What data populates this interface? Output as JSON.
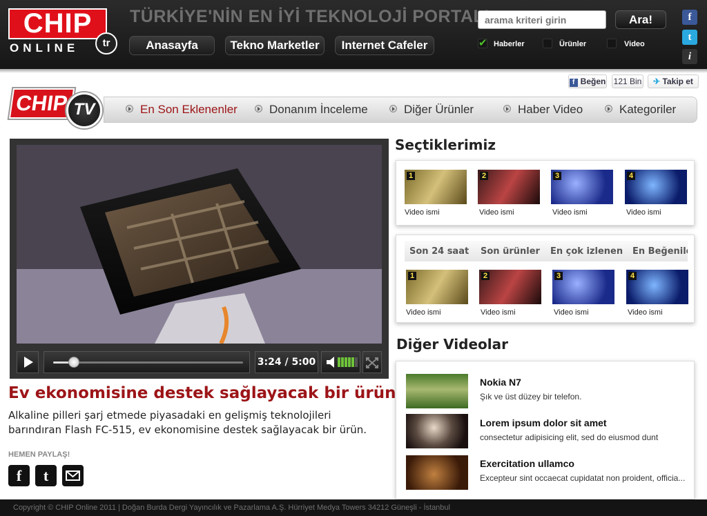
{
  "header": {
    "logo_main": "CHIP",
    "logo_sub": "ONLINE",
    "logo_badge": "tr",
    "tagline": "TÜRKİYE'NİN EN İYİ TEKNOLOJİ PORTALI",
    "nav": [
      "Anasayfa",
      "Tekno Marketler",
      "Internet Cafeler"
    ],
    "search_placeholder": "arama kriteri girin",
    "search_button": "Ara!",
    "filters": [
      {
        "label": "Haberler",
        "checked": true
      },
      {
        "label": "Ürünler",
        "checked": false
      },
      {
        "label": "Video",
        "checked": false
      }
    ],
    "social_icons": [
      "facebook-icon",
      "twitter-icon",
      "info-icon"
    ]
  },
  "social_strip": {
    "like_label": "Beğen",
    "like_count": "121 Bin",
    "follow_label": "Takip et"
  },
  "tv": {
    "logo_main": "CHIP",
    "logo_badge": "TV",
    "nav": [
      {
        "label": "En Son Eklenenler",
        "active": true
      },
      {
        "label": "Donanım İnceleme",
        "active": false
      },
      {
        "label": "Diğer Ürünler",
        "active": false
      },
      {
        "label": "Haber Video",
        "active": false
      },
      {
        "label": "Kategoriler",
        "active": false
      }
    ]
  },
  "player": {
    "current_time": "3:24",
    "separator": "/",
    "duration": "5:00",
    "progress": 0.11,
    "volume_level": 0.8
  },
  "video": {
    "title": "Ev ekonomisine destek sağlayacak bir ürün.",
    "description": "Alkaline pilleri şarj etmede piyasadaki en gelişmiş teknolojileri barındıran Flash FC-515, ev ekonomisine destek sağlayacak bir ürün.",
    "share_label": "HEMEN PAYLAŞ!"
  },
  "picks": {
    "heading": "Seçtiklerimiz",
    "items": [
      {
        "num": "1",
        "caption": "Video ismi"
      },
      {
        "num": "2",
        "caption": "Video ismi"
      },
      {
        "num": "3",
        "caption": "Video ismi"
      },
      {
        "num": "4",
        "caption": "Video ismi"
      }
    ]
  },
  "tabs": {
    "labels": [
      "Son 24 saat",
      "Son ürünler",
      "En çok izlenen",
      "En Beğenile"
    ],
    "items": [
      {
        "num": "1",
        "caption": "Video ismi"
      },
      {
        "num": "2",
        "caption": "Video ismi"
      },
      {
        "num": "3",
        "caption": "Video ismi"
      },
      {
        "num": "4",
        "caption": "Video ismi"
      }
    ]
  },
  "other_videos": {
    "heading": "Diğer Videolar",
    "items": [
      {
        "title": "Nokia N7",
        "desc": "Şık ve üst düzey bir telefon."
      },
      {
        "title": "Lorem ipsum dolor sit amet",
        "desc": "consectetur adipisicing elit, sed do eiusmod dunt"
      },
      {
        "title": "Exercitation ullamco",
        "desc": "Excepteur sint occaecat cupidatat non proident, officia..."
      }
    ]
  },
  "footer": {
    "text": "Copyright © CHIP Online 2011 | Doğan Burda Dergi Yayıncılık ve Pazarlama A.Ş.   Hürriyet Medya Towers 34212 Güneşli - İstanbul"
  },
  "colors": {
    "brand_red": "#d8121b",
    "title_red": "#9c1417",
    "check_green": "#4fbf2a"
  }
}
